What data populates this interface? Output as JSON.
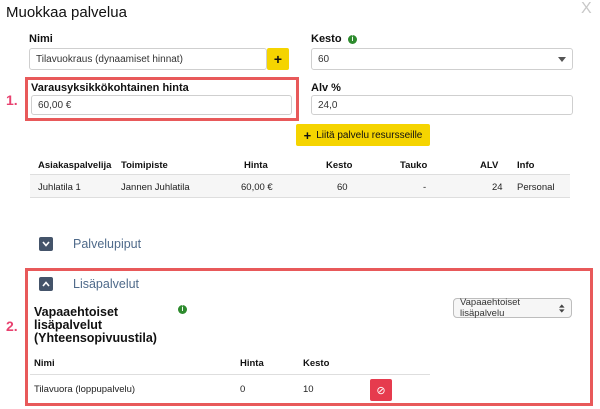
{
  "dialog": {
    "title": "Muokkaa palvelua",
    "close_label": "X"
  },
  "form": {
    "name_label": "Nimi",
    "name_value": "Tilavuokraus (dynaamiset hinnat)",
    "add_symbol": "+",
    "duration_label": "Kesto",
    "duration_value": "60",
    "price_label": "Varausyksikkökohtainen hinta",
    "price_value": "60,00 €",
    "vat_label": "Alv %",
    "vat_value": "24,0",
    "attach_button": "Liitä palvelu resursseille"
  },
  "markers": {
    "one": "1.",
    "two": "2."
  },
  "service_table": {
    "headers": [
      "Asiakaspalvelija",
      "Toimipiste",
      "Hinta",
      "Kesto",
      "Tauko",
      "ALV",
      "Info"
    ],
    "rows": [
      [
        "Juhlatila 1",
        "Jannen Juhlatila",
        "60,00 €",
        "60",
        "-",
        "24",
        "Personal"
      ]
    ]
  },
  "sections": {
    "packages": "Palvelupiput",
    "extras": "Lisäpalvelut"
  },
  "extras": {
    "heading_line1": "Vapaaehtoiset",
    "heading_line2": "lisäpalvelut",
    "heading_line3": "(Yhteensopivuustila)",
    "select_value": "Vapaaehtoiset lisäpalvelu",
    "headers": [
      "Nimi",
      "Hinta",
      "Kesto"
    ],
    "rows": [
      [
        "Tilavuora (loppupalvelu)",
        "0",
        "10"
      ]
    ],
    "delete_symbol": "⊘"
  },
  "icons": {
    "info": "info-icon",
    "chevron_down": "chevron-down-icon",
    "chevron_up": "chevron-up-icon",
    "select_caret": "caret-down-icon",
    "select_updown": "updown-icon"
  },
  "colors": {
    "accent_yellow": "#f5d400",
    "highlight_red": "#e8595a",
    "marker_pink": "#e8416f",
    "delete_red": "#e63b4e"
  }
}
